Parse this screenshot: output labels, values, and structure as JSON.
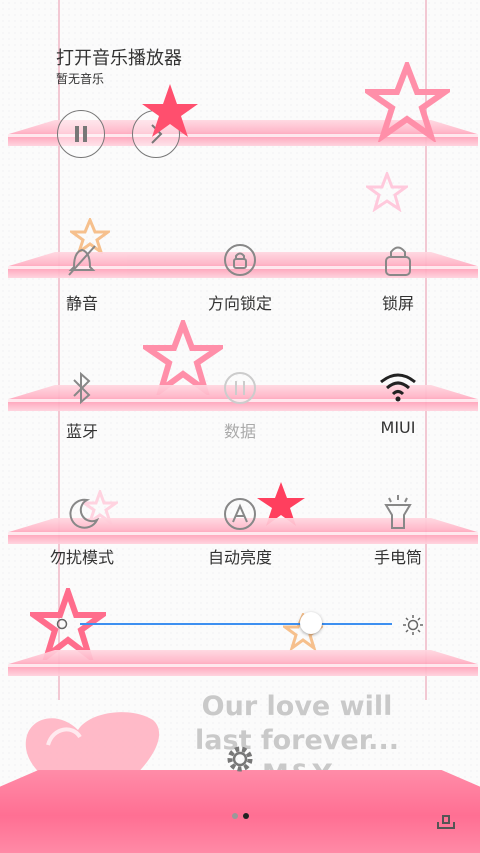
{
  "media": {
    "title": "打开音乐播放器",
    "subtitle": "暂无音乐",
    "pause_icon": "pause-icon",
    "next_icon": "next-icon"
  },
  "toggles": [
    {
      "label": "静音",
      "icon": "bell-off-icon",
      "dim": false
    },
    {
      "label": "方向锁定",
      "icon": "rotation-lock-icon",
      "dim": false
    },
    {
      "label": "锁屏",
      "icon": "lock-icon",
      "dim": false
    },
    {
      "label": "蓝牙",
      "icon": "bluetooth-icon",
      "dim": false
    },
    {
      "label": "数据",
      "icon": "data-icon",
      "dim": true
    },
    {
      "label": "MIUI",
      "icon": "wifi-icon",
      "dim": false
    },
    {
      "label": "勿扰模式",
      "icon": "moon-icon",
      "dim": false
    },
    {
      "label": "自动亮度",
      "icon": "auto-brightness-icon",
      "dim": false
    },
    {
      "label": "手电筒",
      "icon": "flashlight-icon",
      "dim": false
    }
  ],
  "brightness": {
    "level": 0.74,
    "min_icon": "dim-sun-icon",
    "max_icon": "sun-icon"
  },
  "tagline": "Our love will last forever... M&Y",
  "settings_icon": "gear-icon",
  "pager": {
    "pages": 2,
    "current": 1
  },
  "colors": {
    "accent": "#3d8ff0",
    "pink": "#ff8ca8",
    "star": "#ff5c7a"
  }
}
